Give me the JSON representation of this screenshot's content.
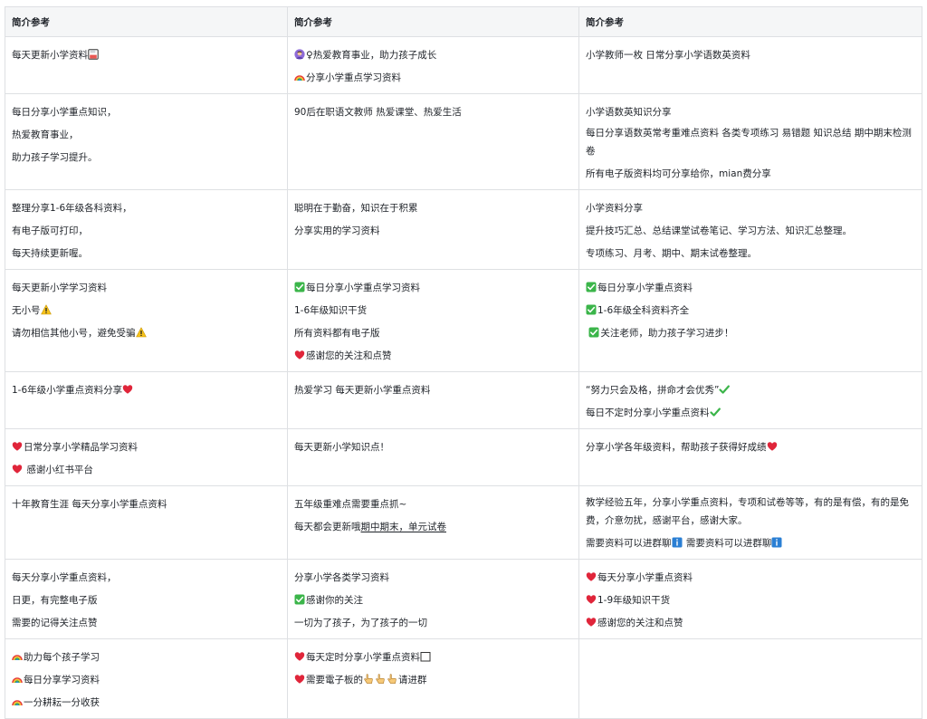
{
  "header": {
    "col1": "简介参考",
    "col2": "简介参考",
    "col3": "简介参考"
  },
  "rows": [
    {
      "c1": [
        "每天更新小学资料"
      ],
      "c2": [
        "♀热爱教育事业，助力孩子成长",
        "分享小学重点学习资料"
      ],
      "c3": [
        "小学教师一枚 日常分享小学语数英资料"
      ]
    },
    {
      "c1": [
        "每日分享小学重点知识，",
        "热爱教育事业，",
        "助力孩子学习提升。"
      ],
      "c2": [
        "90后在职语文教师 热爱课堂、热爱生活"
      ],
      "c3": [
        "小学语数英知识分享",
        "每日分享语数英常考重难点资料 各类专项练习 易错题 知识总结  期中期末检测卷",
        "所有电子版资料均可分享给你，mian费分享"
      ]
    },
    {
      "c1": [
        "整理分享1-6年级各科资料，",
        "有电子版可打印，",
        "每天持续更新喔。"
      ],
      "c2": [
        "聪明在于勤奋，知识在于积累",
        "分享实用的学习资料"
      ],
      "c3": [
        "小学资料分享",
        "提升技巧汇总、总结课堂试卷笔记、学习方法、知识汇总整理。",
        "专项练习、月考、期中、期末试卷整理。"
      ]
    },
    {
      "c1": [
        "每天更新小学学习资料",
        " 无小号",
        "请勿相信其他小号，避免受骗"
      ],
      "c2": [
        "每日分享小学重点学习资料",
        "1-6年级知识干货",
        "所有资料都有电子版",
        "感谢您的关注和点赞"
      ],
      "c3": [
        "每日分享小学重点资料",
        "1-6年级全科资料齐全",
        "关注老师，助力孩子学习进步！"
      ]
    },
    {
      "c1": [
        "1-6年级小学重点资料分享"
      ],
      "c2": [
        "热爱学习 每天更新小学重点资料"
      ],
      "c3": [
        "“努力只会及格，拼命才会优秀”",
        "每日不定时分享小学重点资料"
      ]
    },
    {
      "c1": [
        "日常分享小学精品学习资料",
        " 感谢小红书平台"
      ],
      "c2": [
        "每天更新小学知识点！"
      ],
      "c3": [
        "分享小学各年级资料，帮助孩子获得好成绩"
      ]
    },
    {
      "c1": [
        "十年教育生涯 每天分享小学重点资料"
      ],
      "c2": [
        "五年级重难点需要重点抓~",
        "每天都会更新哦",
        "期中期末，单元试卷"
      ],
      "c3": [
        "教学经验五年，分享小学重点资料，专项和试卷等等，有的是有偿，有的是免费，介意勿扰，感谢平台，感谢大家。",
        " 需要资料可以进群聊",
        " 需要资料可以进群聊"
      ]
    },
    {
      "c1": [
        "每天分享小学重点资料，",
        "日更，有完整电子版",
        "需要的记得关注点赞"
      ],
      "c2": [
        "分享小学各类学习资料",
        "感谢你的关注",
        "一切为了孩子，为了孩子的一切"
      ],
      "c3": [
        "每天分享小学重点资料",
        "1-9年级知识干货",
        "感谢您的关注和点赞"
      ]
    },
    {
      "c1": [
        "助力每个孩子学习",
        "每日分享学习资料",
        "一分耕耘一分收获"
      ],
      "c2": [
        "每天定时分享小学重点资料",
        "需要電子板的",
        "请进群"
      ],
      "c3": []
    }
  ],
  "icons": {
    "floppy": "floppy-disk-icon",
    "teacher": "teacher-icon",
    "rainbow": "rainbow-icon",
    "warning": "warning-icon",
    "heart": "heart-icon",
    "check": "check-box-icon",
    "checkmark": "check-mark-icon",
    "info": "info-icon",
    "point": "pointing-hand-icon",
    "blank": "blank-square-icon"
  },
  "colors": {
    "border": "#dee0e3",
    "header_bg": "#f5f6f7",
    "heart": "#e0253a",
    "check": "#3bb54a",
    "info": "#2a7fd4"
  }
}
